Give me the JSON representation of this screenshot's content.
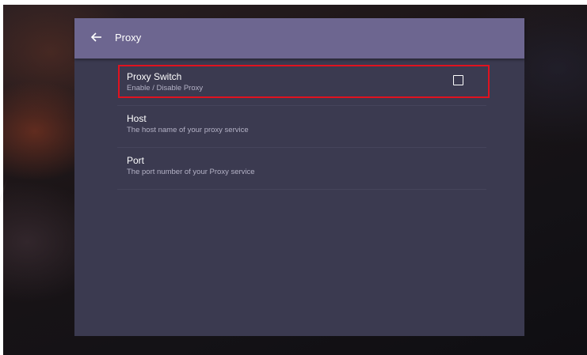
{
  "header": {
    "title": "Proxy",
    "back_icon": "arrow-left-icon"
  },
  "colors": {
    "header_bg": "#6d6690",
    "panel_bg": "#3b3a50",
    "highlight": "#e0121f"
  },
  "settings": [
    {
      "title": "Proxy Switch",
      "summary": "Enable / Disable Proxy",
      "has_checkbox": true,
      "checked": false
    },
    {
      "title": "Host",
      "summary": "The host name of your proxy service",
      "has_checkbox": false
    },
    {
      "title": "Port",
      "summary": "The port number of your Proxy service",
      "has_checkbox": false
    }
  ]
}
